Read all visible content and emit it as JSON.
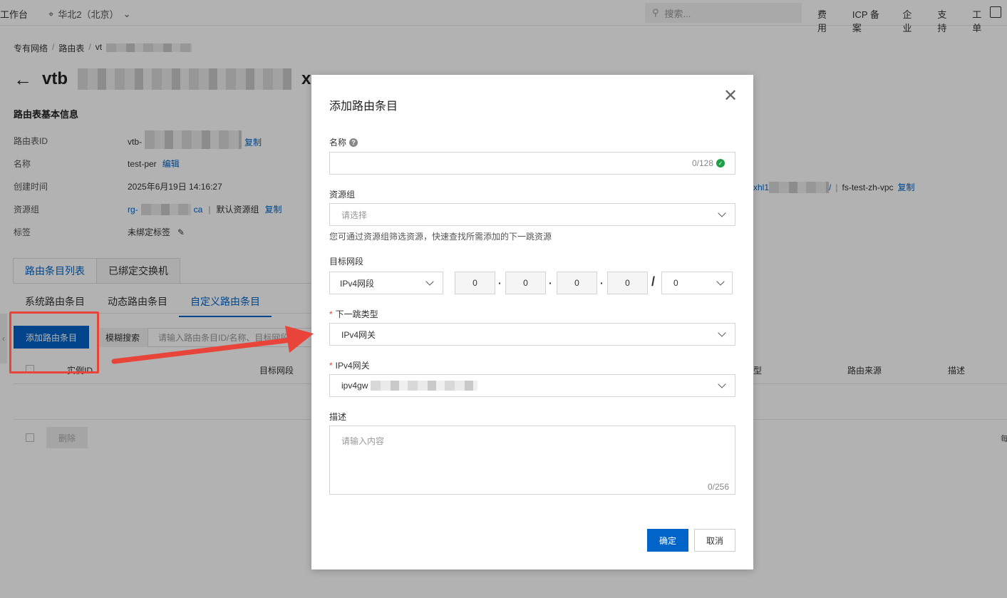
{
  "topbar": {
    "workbench": "工作台",
    "region": "华北2（北京）",
    "search_placeholder": "搜索...",
    "links": [
      "费用",
      "ICP 备案",
      "企业",
      "支持",
      "工单"
    ]
  },
  "breadcrumb": [
    "专有网络",
    "路由表",
    "vt"
  ],
  "page_title": "vtb",
  "title_suffix": "x",
  "basic_info": {
    "section_title": "路由表基本信息",
    "rows": [
      {
        "key": "路由表ID",
        "value": "vtb-",
        "action": "复制"
      },
      {
        "key": "名称",
        "value": "test-per",
        "action": "编辑"
      },
      {
        "key": "创建时间",
        "value": "2025年6月19日 14:16:27"
      },
      {
        "key": "资源组",
        "value": "rg-",
        "value_tail": "ca",
        "extra": "默认资源组",
        "action": "复制"
      },
      {
        "key": "标签",
        "value": "未绑定标签"
      }
    ],
    "vpc_prefix": "xhl1",
    "vpc_suffix": "/",
    "vpc_name": "fs-test-zh-vpc",
    "vpc_action": "复制"
  },
  "tabs": [
    "路由条目列表",
    "已绑定交换机"
  ],
  "subtabs": [
    "系统路由条目",
    "动态路由条目",
    "自定义路由条目"
  ],
  "toolbar": {
    "add_label": "添加路由条目",
    "fuzzy_label": "模糊搜索",
    "filter_placeholder": "请输入路由条目ID/名称、目标网段"
  },
  "table": {
    "headers": [
      "实例ID",
      "目标网段",
      "型",
      "路由来源",
      "描述"
    ],
    "delete_label": "删除",
    "page_cut": "每"
  },
  "modal": {
    "title": "添加路由条目",
    "name_label": "名称",
    "name_counter": "0/128",
    "resource_group_label": "资源组",
    "resource_group_placeholder": "请选择",
    "resource_group_hint": "您可通过资源组筛选资源，快速查找所需添加的下一跳资源",
    "dest_label": "目标网段",
    "dest_type": "IPv4网段",
    "octets": [
      "0",
      "0",
      "0",
      "0"
    ],
    "mask": "0",
    "nexthop_type_label": "下一跳类型",
    "nexthop_type_value": "IPv4网关",
    "gateway_label": "IPv4网关",
    "gateway_value": "ipv4gw",
    "desc_label": "描述",
    "desc_placeholder": "请输入内容",
    "desc_counter": "0/256",
    "ok_label": "确定",
    "cancel_label": "取消"
  },
  "colors": {
    "primary": "#0064c8",
    "highlight": "#e8443a",
    "success": "#1e9e47"
  }
}
